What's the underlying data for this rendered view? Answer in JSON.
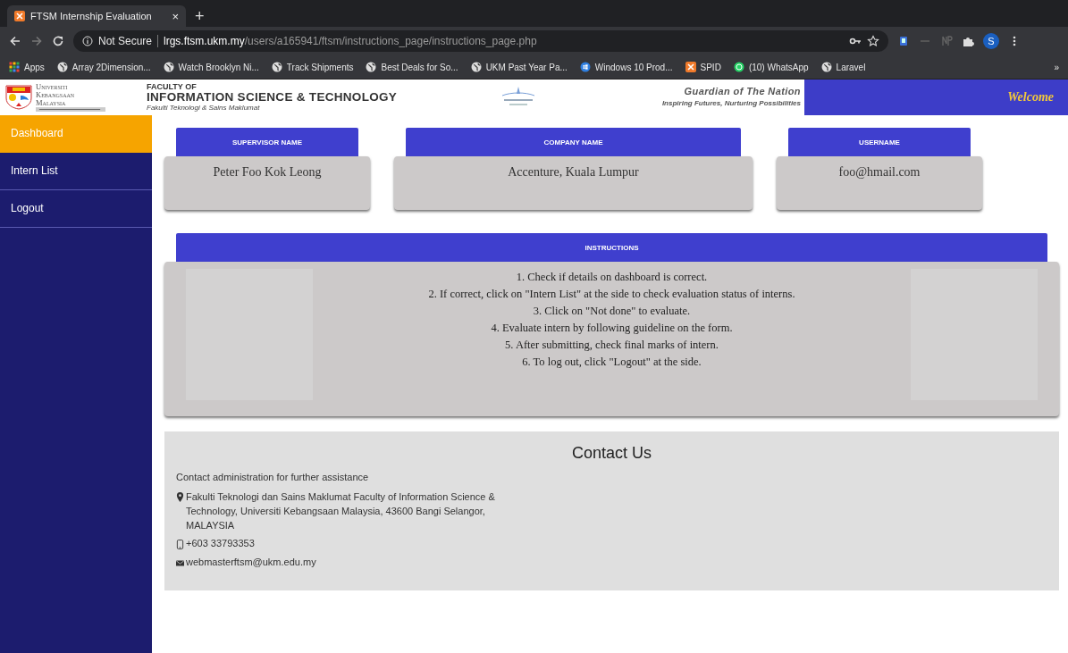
{
  "browser": {
    "tab": {
      "title": "FTSM Internship Evaluation",
      "close": "×",
      "new_tab": "+"
    },
    "address": {
      "security": "Not Secure",
      "host": "lrgs.ftsm.ukm.my",
      "path": "/users/a165941/ftsm/instructions_page/instructions_page.php"
    },
    "avatar": "S",
    "bookmarks": [
      {
        "label": "Apps",
        "kind": "apps"
      },
      {
        "label": "Array 2Dimension...",
        "kind": "site"
      },
      {
        "label": "Watch Brooklyn Ni...",
        "kind": "site"
      },
      {
        "label": "Track Shipments",
        "kind": "site"
      },
      {
        "label": "Best Deals for So...",
        "kind": "site"
      },
      {
        "label": "UKM Past Year Pa...",
        "kind": "site"
      },
      {
        "label": "Windows 10 Prod...",
        "kind": "windows"
      },
      {
        "label": "SPID",
        "kind": "xampp"
      },
      {
        "label": "(10) WhatsApp",
        "kind": "chat"
      },
      {
        "label": "Laravel",
        "kind": "site"
      }
    ],
    "overflow": "»"
  },
  "header": {
    "university": [
      "Universiti",
      "Kebangsaan",
      "Malaysia"
    ],
    "faculty_of": "FACULTY OF",
    "faculty": "INFORMATION SCIENCE & TECHNOLOGY",
    "faculty_malay": "Fakulti Teknologi & Sains Maklumat",
    "motto": "Guardian of The Nation",
    "tagline": "Inspiring Futures, Nurturing Possibilities",
    "welcome": "Welcome"
  },
  "sidebar": [
    {
      "label": "Dashboard",
      "selected": true
    },
    {
      "label": "Intern List",
      "selected": false
    },
    {
      "label": "Logout",
      "selected": false
    }
  ],
  "info_cards": [
    {
      "label": "SUPERVISOR NAME",
      "value": "Peter Foo Kok Leong"
    },
    {
      "label": "COMPANY NAME",
      "value": "Accenture, Kuala Lumpur"
    },
    {
      "label": "USERNAME",
      "value": "foo@hmail.com"
    }
  ],
  "instructions": {
    "title": "INSTRUCTIONS",
    "steps": [
      "1. Check if details on dashboard is correct.",
      "2. If correct, click on \"Intern List\" at the side to check evaluation status of interns.",
      "3. Click on \"Not done\" to evaluate.",
      "4. Evaluate intern by following guideline on the form.",
      "5. After submitting, check final marks of intern.",
      "6. To log out, click \"Logout\" at the side."
    ]
  },
  "contact": {
    "title": "Contact Us",
    "intro": "Contact administration for further assistance",
    "address": "Fakulti Teknologi dan Sains Maklumat Faculty of Information Science & Technology, Universiti Kebangsaan Malaysia, 43600 Bangi Selangor, MALAYSIA",
    "phone": "+603 33793353",
    "email": "webmasterftsm@ukm.edu.my"
  }
}
